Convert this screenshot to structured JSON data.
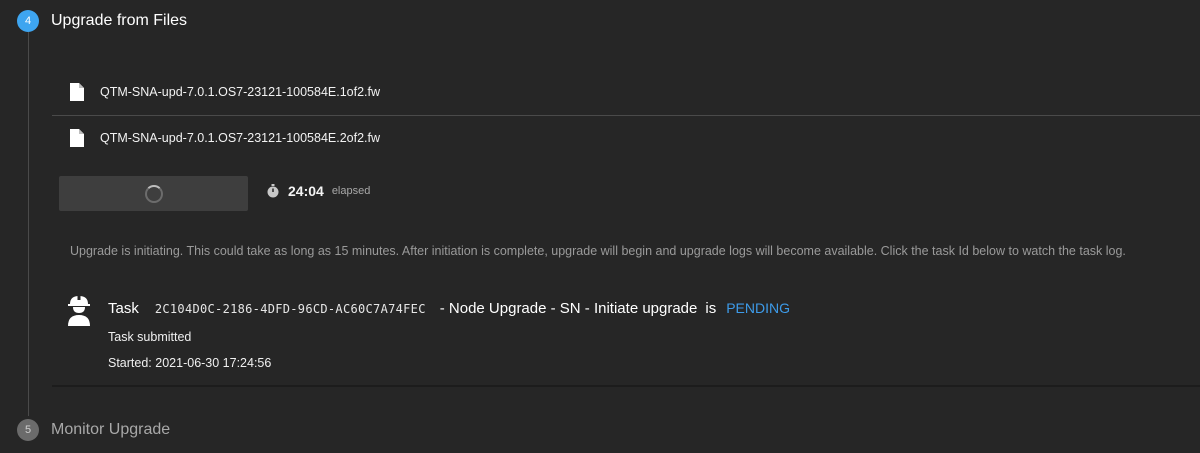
{
  "steps": {
    "current": {
      "number": "4",
      "title": "Upgrade from Files"
    },
    "next": {
      "number": "5",
      "title": "Monitor Upgrade"
    }
  },
  "files": [
    {
      "name": "QTM-SNA-upd-7.0.1.OS7-23121-100584E.1of2.fw",
      "icon": "file-icon"
    },
    {
      "name": "QTM-SNA-upd-7.0.1.OS7-23121-100584E.2of2.fw",
      "icon": "file-icon"
    }
  ],
  "progress": {
    "elapsed_time": "24:04",
    "elapsed_label": "elapsed",
    "icon": "stopwatch-icon"
  },
  "info_message": "Upgrade is initiating. This could take as long as 15 minutes. After initiation is complete, upgrade will begin and upgrade logs will become available. Click the task Id below to watch the task log.",
  "task": {
    "label": "Task",
    "id": "2C104D0C-2186-4DFD-96CD-AC60C7A74FEC",
    "description": "- Node Upgrade - SN - Initiate upgrade",
    "is_word": "is",
    "status": "PENDING",
    "status_color": "#3d9be9",
    "submitted_text": "Task submitted",
    "started_label": "Started:",
    "started_value": "2021-06-30 17:24:56",
    "icon": "worker-icon"
  },
  "colors": {
    "background": "#262626",
    "accent": "#3ea5f0",
    "inactive_step": "#6b6b6b"
  }
}
